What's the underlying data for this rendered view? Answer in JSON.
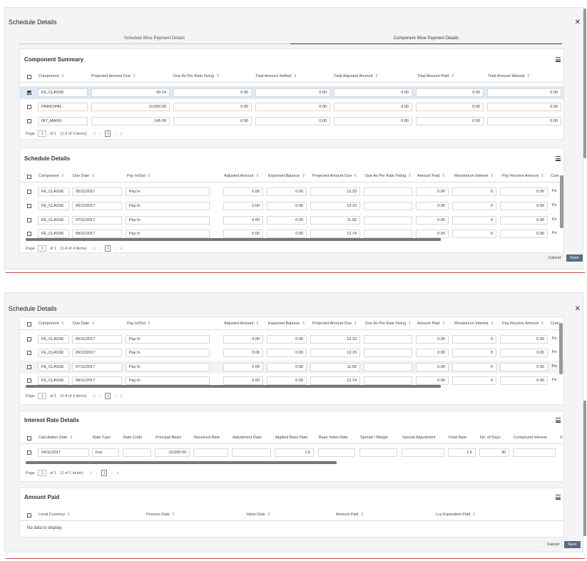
{
  "top": {
    "title": "Schedule Details",
    "tabs": [
      "Schedule Wise Payment Details",
      "Component Wise Payment Details"
    ],
    "component_summary": {
      "title": "Component Summary",
      "headers": [
        "Component",
        "Projected Amount Due",
        "Due As Per Rate Fixing",
        "Total Amount Settled",
        "Total Adjusted Amount",
        "Total Amount Paid",
        "Total Amount Waived"
      ],
      "rows": [
        [
          "FE_CLASS6",
          "50.14",
          "0.00",
          "0.00",
          "0.00",
          "0.00",
          "0.00"
        ],
        [
          "PRINCIPAL",
          "10,000.00",
          "0.00",
          "0.00",
          "0.00",
          "0.00",
          "0.00"
        ],
        [
          "INT_MAIN1",
          "145.09",
          "0.00",
          "0.00",
          "0.00",
          "0.00",
          "0.00"
        ]
      ],
      "pager": {
        "page_label": "Page",
        "page": "1",
        "of": "of 1",
        "items": "(1-3 of 3 items)",
        "current": "1"
      }
    },
    "schedule_details": {
      "title": "Schedule Details",
      "headers": [
        "Component",
        "Due Date",
        "Pay In/Out",
        "Adjusted Amount",
        "Expected Balance",
        "Projected Amount Due",
        "Due As Per Rate Fixing",
        "Amount Paid",
        "Moratorium Interest",
        "Pay Receive Amount",
        "Com"
      ],
      "rows": [
        [
          "FE_CLASS6",
          "05/11/2017",
          "Pay In",
          "0.00",
          "0.00",
          "12.33",
          "",
          "0.00",
          "0",
          "0.00",
          "Fe"
        ],
        [
          "FE_CLASS6",
          "06/12/2017",
          "Pay In",
          "0.00",
          "0.00",
          "13.15",
          "",
          "0.00",
          "0",
          "0.00",
          "Fe"
        ],
        [
          "FE_CLASS6",
          "07/11/2017",
          "Pay In",
          "0.00",
          "0.00",
          "11.92",
          "",
          "0.00",
          "0",
          "0.00",
          "Fe"
        ],
        [
          "FE_CLASS6",
          "08/11/2017",
          "Pay In",
          "0.00",
          "0.00",
          "12.74",
          "",
          "0.00",
          "0",
          "0.00",
          "Fe"
        ]
      ],
      "pager": {
        "page_label": "Page",
        "page": "1",
        "of": "of 1",
        "items": "(1-4 of 4 items)",
        "current": "1"
      }
    },
    "buttons": {
      "cancel": "Cancel",
      "save": "Save"
    }
  },
  "bottom": {
    "title": "Schedule Details",
    "schedule_details": {
      "headers": [
        "Component",
        "Due Date",
        "Pay In/Out",
        "Adjusted Amount",
        "Expected Balance",
        "Projected Amount Due",
        "Due As Per Rate Fixing",
        "Amount Paid",
        "Moratorium Interest",
        "Pay Receive Amount",
        "Com"
      ],
      "rows": [
        [
          "FE_CLASS6",
          "05/11/2017",
          "Pay In",
          "0.00",
          "0.00",
          "12.33",
          "",
          "0.00",
          "0",
          "0.00",
          "Fe"
        ],
        [
          "FE_CLASS6",
          "06/12/2017",
          "Pay In",
          "0.00",
          "0.00",
          "13.15",
          "",
          "0.00",
          "0",
          "0.00",
          "Fe"
        ],
        [
          "FE_CLASS6",
          "07/11/2017",
          "Pay In",
          "0.00",
          "0.00",
          "11.92",
          "",
          "0.00",
          "0",
          "0.00",
          "Fe"
        ],
        [
          "FE_CLASS6",
          "08/11/2017",
          "Pay In",
          "0.00",
          "0.00",
          "12.74",
          "",
          "0.00",
          "0",
          "0.00",
          "Fe"
        ]
      ],
      "pager": {
        "page_label": "Page",
        "page": "1",
        "of": "of 1",
        "items": "(1-4 of 4 items)",
        "current": "1"
      }
    },
    "interest_rate": {
      "title": "Interest Rate Details",
      "headers": [
        "Calculation Date",
        "Rate Type",
        "Rate Code",
        "Principal Basis",
        "Received Rate",
        "Adjustment Rate",
        "Applied Base Rate",
        "Base Index Rate",
        "Spread / Margin",
        "Spread Adjustment",
        "Final Rate",
        "No. of Days",
        "Compound Interest",
        "S"
      ],
      "row": [
        "04/11/2017",
        "Fee",
        "",
        "10,000.00",
        "",
        "",
        "1.5",
        "",
        "",
        "",
        "1.5",
        "30",
        ""
      ],
      "pager": {
        "page_label": "Page",
        "page": "1",
        "of": "of 1",
        "items": "(1 of 1 items)",
        "current": "1"
      }
    },
    "amount_paid": {
      "title": "Amount Paid",
      "headers": [
        "Local Currency",
        "Process Date",
        "Value Date",
        "Amount Paid",
        "Lcy Equivalent Paid"
      ],
      "empty": "No data to display."
    },
    "buttons": {
      "cancel": "Cancel",
      "save": "Save"
    }
  },
  "icons": {
    "close": "close-icon",
    "menu": "column-menu-icon",
    "sort": "sort-icon",
    "checkbox": "checkbox-icon"
  }
}
